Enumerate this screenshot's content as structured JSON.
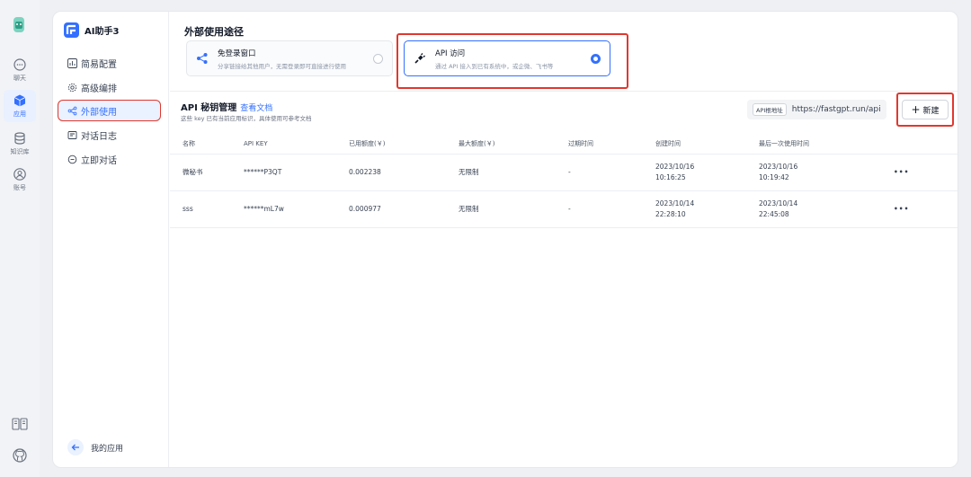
{
  "rail": {
    "items": [
      {
        "label": "聊天",
        "icon": "chat-icon"
      },
      {
        "label": "应用",
        "icon": "app-cube-icon"
      },
      {
        "label": "知识库",
        "icon": "database-icon"
      },
      {
        "label": "账号",
        "icon": "user-icon"
      }
    ],
    "bottom_icons": [
      "docs-book-icon",
      "github-icon"
    ]
  },
  "app": {
    "name": "AI助手3"
  },
  "menu": {
    "items": [
      {
        "label": "简易配置",
        "icon": "chart-icon"
      },
      {
        "label": "高级编排",
        "icon": "gear-icon"
      },
      {
        "label": "外部使用",
        "icon": "share-icon"
      },
      {
        "label": "对话日志",
        "icon": "log-icon"
      },
      {
        "label": "立即对话",
        "icon": "chat-bubble-icon"
      }
    ],
    "back_label": "我的应用"
  },
  "usage": {
    "title": "外部使用途径",
    "options": [
      {
        "title": "免登录窗口",
        "desc": "分享链接给其他用户，无需登录即可直接进行使用",
        "selected": false
      },
      {
        "title": "API 访问",
        "desc": "通过 API 接入到已有系统中，或企微、飞书等",
        "selected": true
      }
    ]
  },
  "api": {
    "title": "API 秘钥管理",
    "doc_link": "查看文档",
    "subtitle": "这些 key 已有当前应用标识，具体使用可参考文档",
    "base_url_tag": "API根地址",
    "base_url": "https://fastgpt.run/api",
    "new_label": "新建",
    "columns": [
      "名称",
      "API KEY",
      "已用额度(￥)",
      "最大额度(￥)",
      "过期时间",
      "创建时间",
      "最后一次使用时间"
    ],
    "rows": [
      {
        "name": "微秘书",
        "key": "******P3QT",
        "used": "0.002238",
        "max": "无限制",
        "expire": "-",
        "created_date": "2023/10/16",
        "created_time": "10:16:25",
        "last_date": "2023/10/16",
        "last_time": "10:19:42",
        "more": "•••"
      },
      {
        "name": "sss",
        "key": "******mL7w",
        "used": "0.000977",
        "max": "无限制",
        "expire": "-",
        "created_date": "2023/10/14",
        "created_time": "22:28:10",
        "last_date": "2023/10/14",
        "last_time": "22:45:08",
        "more": "•••"
      }
    ]
  },
  "colors": {
    "accent": "#3370ff",
    "highlight": "#e0382f"
  }
}
